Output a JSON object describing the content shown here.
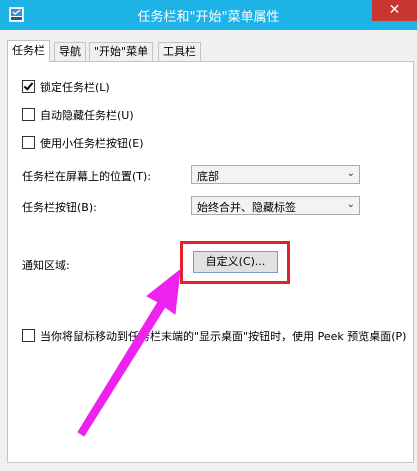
{
  "window": {
    "title": "任务栏和\"开始\"菜单属性",
    "close_label": "✕"
  },
  "tabs": [
    {
      "label": "任务栏",
      "active": true
    },
    {
      "label": "导航",
      "active": false
    },
    {
      "label": "\"开始\"菜单",
      "active": false
    },
    {
      "label": "工具栏",
      "active": false
    }
  ],
  "options": {
    "lock_taskbar": {
      "label": "锁定任务栏(L)",
      "checked": true
    },
    "auto_hide": {
      "label": "自动隐藏任务栏(U)",
      "checked": false
    },
    "small_buttons": {
      "label": "使用小任务栏按钮(E)",
      "checked": false
    }
  },
  "position": {
    "label": "任务栏在屏幕上的位置(T):",
    "value": "底部"
  },
  "buttons_setting": {
    "label": "任务栏按钮(B):",
    "value": "始终合并、隐藏标签"
  },
  "notification": {
    "label": "通知区域:",
    "button_label": "自定义(C)..."
  },
  "peek": {
    "label": "当你将鼠标移动到任务栏末端的\"显示桌面\"按钮时，使用 Peek 预览桌面(P)",
    "checked": false
  },
  "annotation": {
    "highlight_color": "#e0222a",
    "arrow_color": "#ee22ee"
  },
  "colors": {
    "titlebar": "#1eb3e6",
    "close_button": "#c7372f"
  }
}
